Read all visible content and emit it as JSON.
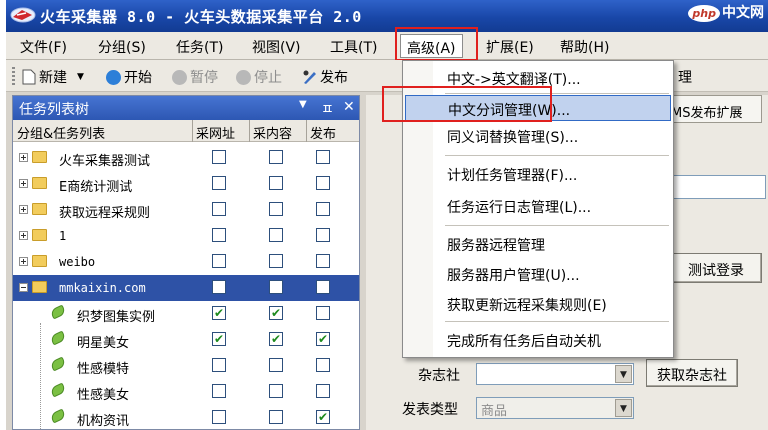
{
  "window": {
    "title": "火车采集器 8.0 - 火车头数据采集平台 2.0"
  },
  "watermark": {
    "badge": "php",
    "text": "中文网"
  },
  "menubar": {
    "items": [
      {
        "label": "文件(F)"
      },
      {
        "label": "分组(S)"
      },
      {
        "label": "任务(T)"
      },
      {
        "label": "视图(V)"
      },
      {
        "label": "工具(T)"
      },
      {
        "label": "高级(A)"
      },
      {
        "label": "扩展(E)"
      },
      {
        "label": "帮助(H)"
      }
    ],
    "active": "高级(A)"
  },
  "toolbar": {
    "new": "新建",
    "start": "开始",
    "pause": "暂停",
    "stop": "停止",
    "publish": "发布"
  },
  "task_panel": {
    "title": "任务列表树",
    "columns": [
      "分组&任务列表",
      "采网址",
      "采内容",
      "发布"
    ],
    "rows": [
      {
        "type": "folder",
        "name": "火车采集器测试",
        "checks": [
          "",
          "",
          ""
        ]
      },
      {
        "type": "folder",
        "name": "E商统计测试",
        "checks": [
          "",
          "",
          ""
        ]
      },
      {
        "type": "folder",
        "name": "获取远程采规则",
        "checks": [
          "",
          "",
          ""
        ]
      },
      {
        "type": "folder",
        "name": "1",
        "checks": [
          "",
          "",
          ""
        ]
      },
      {
        "type": "folder",
        "name": "weibo",
        "checks": [
          "",
          "",
          ""
        ]
      },
      {
        "type": "folder",
        "name": "mmkaixin.com",
        "checks": [
          "",
          "",
          ""
        ],
        "selected": true
      },
      {
        "type": "task",
        "name": "织梦图集实例",
        "checks": [
          "✔",
          "✔",
          ""
        ]
      },
      {
        "type": "task",
        "name": "明星美女",
        "checks": [
          "✔",
          "✔",
          "✔"
        ]
      },
      {
        "type": "task",
        "name": "性感模特",
        "checks": [
          "",
          "",
          ""
        ]
      },
      {
        "type": "task",
        "name": "性感美女",
        "checks": [
          "",
          "",
          ""
        ]
      },
      {
        "type": "task",
        "name": "机构资讯",
        "checks": [
          "",
          "",
          "✔"
        ]
      }
    ]
  },
  "dropdown": {
    "items": [
      {
        "label": "中文->英文翻译(T)..."
      },
      {
        "label": "中文分词管理(W)..."
      },
      {
        "label": "同义词替换管理(S)..."
      },
      {
        "label": "计划任务管理器(F)..."
      },
      {
        "label": "任务运行日志管理(L)..."
      },
      {
        "label": "服务器远程管理"
      },
      {
        "label": "服务器用户管理(U)..."
      },
      {
        "label": "获取更新远程采集规则(E)"
      },
      {
        "label": "完成所有任务后自动关机"
      }
    ],
    "highlighted": "中文分词管理(W)..."
  },
  "right_panel": {
    "tab_label": "MS发布扩展",
    "test_login_button": "测试登录",
    "magazine_label": "杂志社",
    "get_magazine_button": "获取杂志社",
    "publish_type_label": "发表类型",
    "publish_type_value": "商品",
    "partial_label": "理"
  },
  "colors": {
    "highlight_border": "#e0201e",
    "title_bar": "#1947a8",
    "selection": "#2e52a6"
  }
}
